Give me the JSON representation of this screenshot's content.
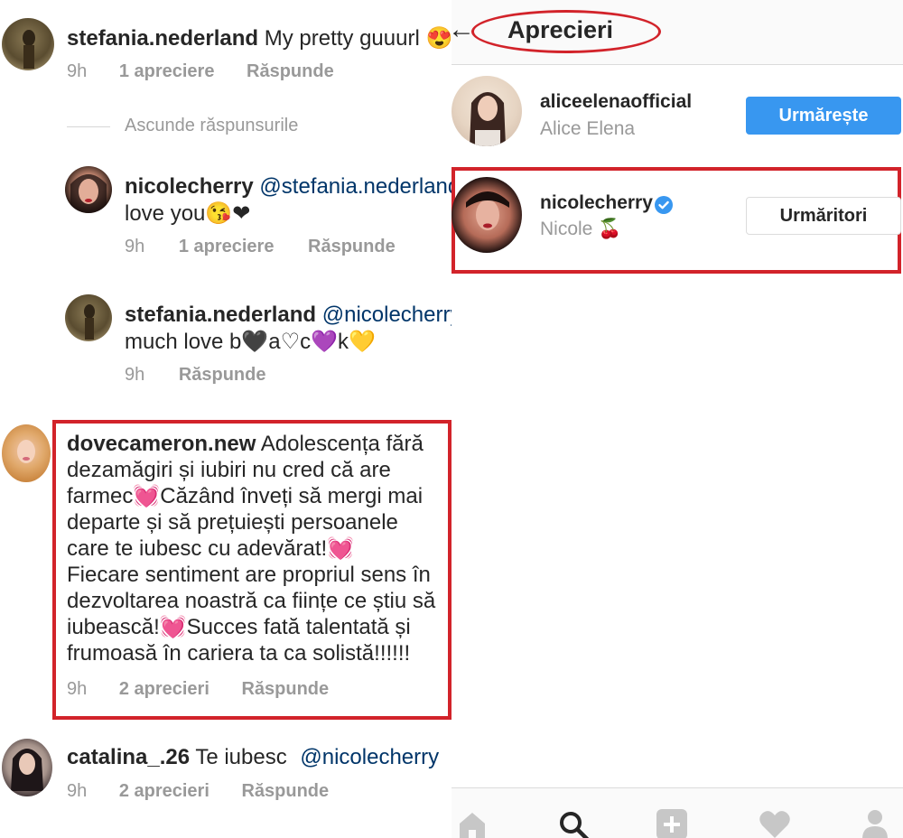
{
  "comments_panel": {
    "hide_replies_label": "Ascunde răspunsurile",
    "comments": [
      {
        "user": "stefania.nederland",
        "text": "My pretty guuurl 😍",
        "time": "9h",
        "likes": "1 apreciere",
        "reply": "Răspunde"
      },
      {
        "user": "nicolecherry",
        "mention": "@stefania.nederland",
        "text": "love you😘❤",
        "time": "9h",
        "likes": "1 apreciere",
        "reply": "Răspunde"
      },
      {
        "user": "stefania.nederland",
        "mention": "@nicolecherry",
        "text": "much love b🖤a♡c💜k💛",
        "time": "9h",
        "reply": "Răspunde"
      },
      {
        "user": "dovecameron.new",
        "lines": [
          "Adolescența fără",
          "dezamăgiri și iubiri nu cred că are",
          "farmec💓Căzând înveți să mergi mai",
          "departe și să prețuiești persoanele",
          "care te iubesc cu adevărat!💓",
          "Fiecare sentiment are propriul sens în",
          "dezvoltarea noastră ca ființe ce știu să",
          "iubească!💓Succes fată talentată și",
          "frumoasă în cariera ta ca solistă!!!!!!"
        ],
        "time": "9h",
        "likes": "2 aprecieri",
        "reply": "Răspunde"
      },
      {
        "user": "catalina_.26",
        "text": "Te iubesc ",
        "mention": "@nicolecherry",
        "time": "9h",
        "likes": "2 aprecieri",
        "reply": "Răspunde"
      }
    ]
  },
  "likes_panel": {
    "title": "Aprecieri",
    "back_icon": "arrow-left-icon",
    "users": [
      {
        "username": "aliceelenaofficial",
        "name": "Alice Elena",
        "button": "Urmărește"
      },
      {
        "username": "nicolecherry",
        "name": "Nicole 🍒",
        "button": "Urmăritori",
        "verified": true
      }
    ],
    "nav_icons": [
      "home-icon",
      "search-icon",
      "add-post-icon",
      "heart-icon",
      "profile-icon"
    ]
  },
  "colors": {
    "highlight_red": "#d2232a",
    "follow_blue": "#3897f0",
    "mention_blue": "#003569",
    "meta_gray": "#999999"
  }
}
